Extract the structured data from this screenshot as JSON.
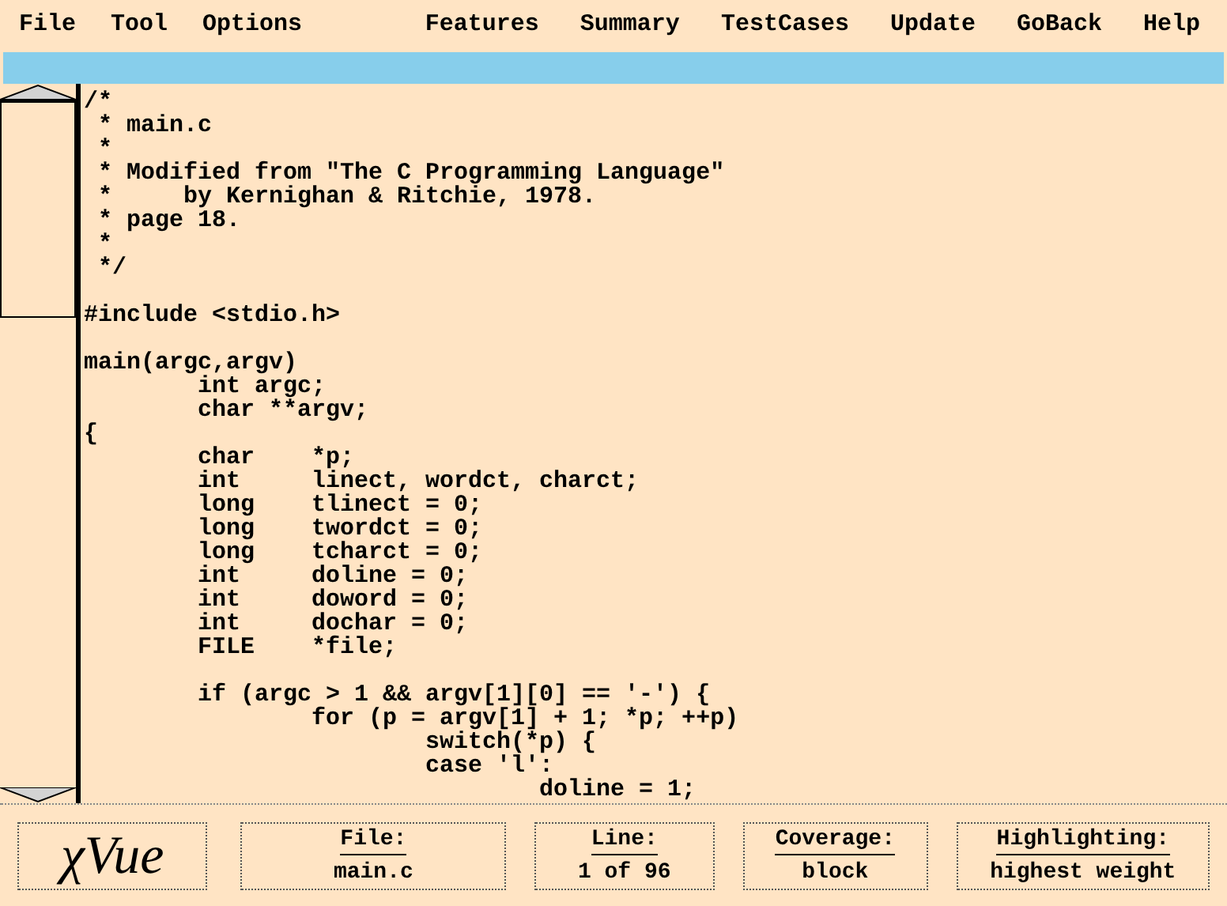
{
  "menu_left": [
    "File",
    "Tool",
    "Options"
  ],
  "menu_right": [
    "Features",
    "Summary",
    "TestCases",
    "Update",
    "GoBack",
    "Help"
  ],
  "code_blocks": [
    [
      "/*",
      " * main.c",
      " *",
      " * Modified from \"The C Programming Language\"",
      " *     by Kernighan & Ritchie, 1978.",
      " * page 18.",
      " *",
      " */"
    ],
    [
      "#include <stdio.h>"
    ],
    [
      "main(argc,argv)",
      "        int argc;",
      "        char **argv;",
      "{",
      "        char    *p;",
      "        int     linect, wordct, charct;",
      "        long    tlinect = 0;",
      "        long    twordct = 0;",
      "        long    tcharct = 0;",
      "        int     doline = 0;",
      "        int     doword = 0;",
      "        int     dochar = 0;",
      "        FILE    *file;"
    ],
    [
      "        if (argc > 1 && argv[1][0] == '-') {",
      "                for (p = argv[1] + 1; *p; ++p)",
      "                        switch(*p) {",
      "                        case 'l':",
      "                                doline = 1;"
    ]
  ],
  "status_bar": {
    "logo": "χVue",
    "fields": [
      {
        "label": "File:",
        "value": "main.c"
      },
      {
        "label": "Line:",
        "value": "1 of 96"
      },
      {
        "label": "Coverage:",
        "value": "block"
      },
      {
        "label": "Highlighting:",
        "value": "highest weight"
      }
    ]
  }
}
